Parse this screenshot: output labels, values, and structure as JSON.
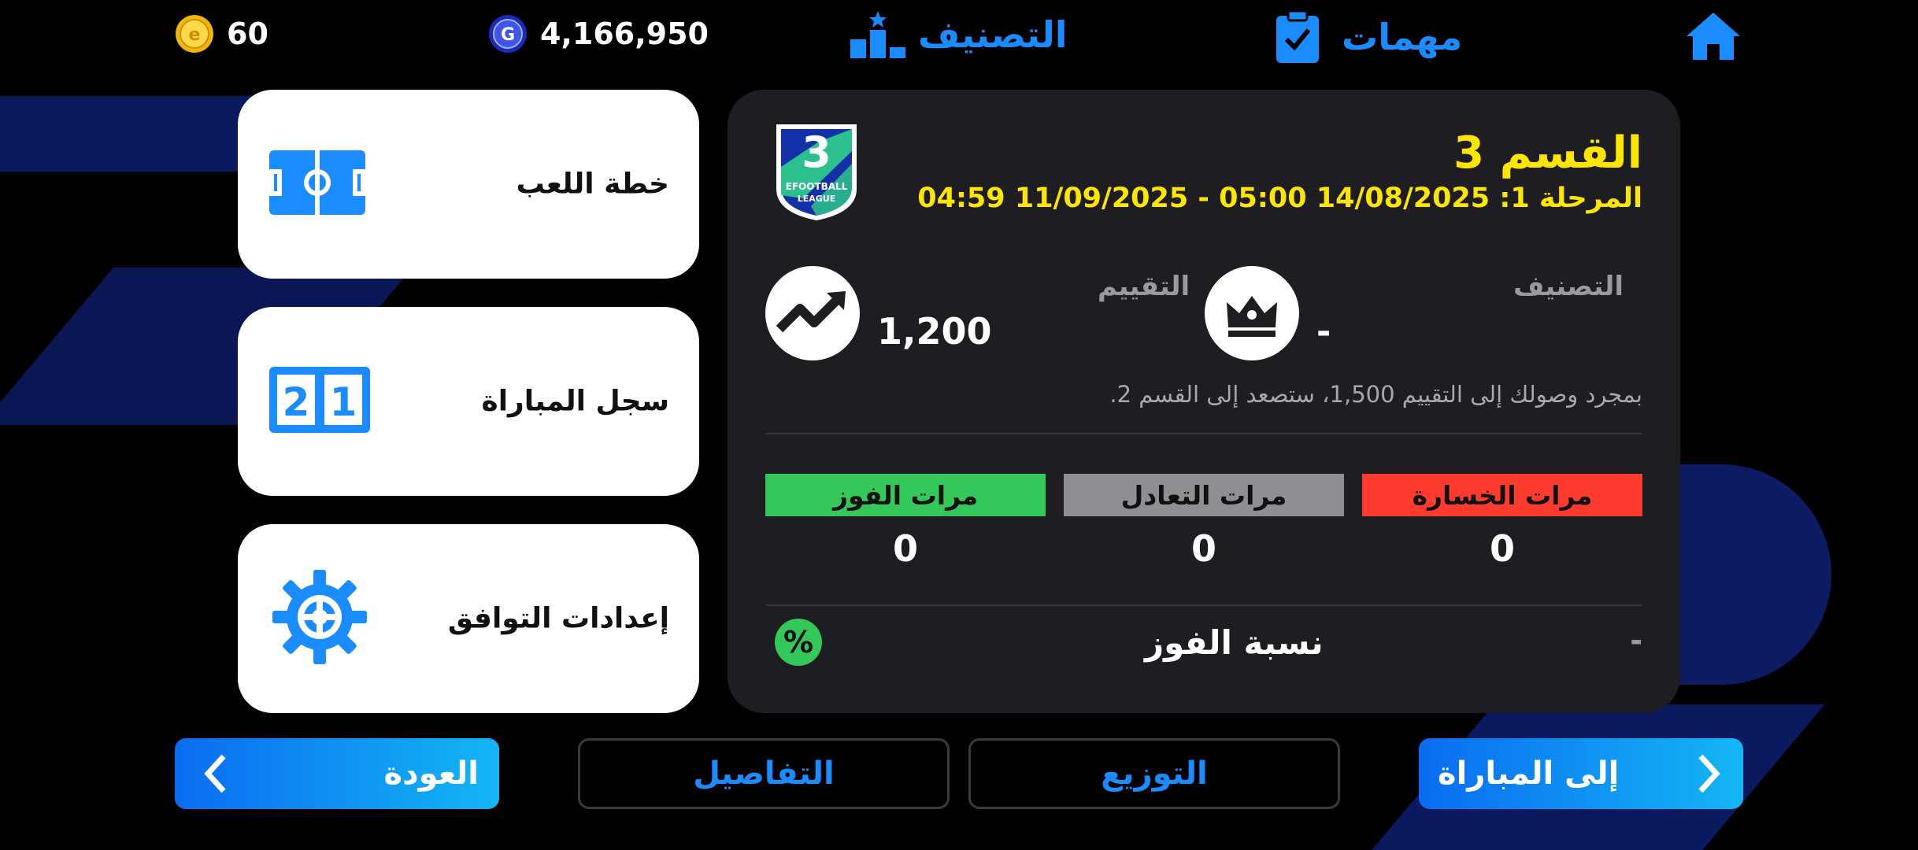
{
  "topbar": {
    "coins": "60",
    "gp": "4,166,950",
    "ranking_label": "التصنيف",
    "missions_label": "مهمات"
  },
  "cards": {
    "game_plan": "خطة اللعب",
    "match_record": "سجل المباراة",
    "compat_settings": "إعدادات التوافق"
  },
  "division": {
    "title": "القسم 3",
    "badge_number": "3",
    "badge_text_1": "EFOOTBALL",
    "badge_text_2": "LEAGUE",
    "phase": "المرحلة 1: 14/08/2025 05:00 - 11/09/2025 04:59",
    "ranking_label": "التصنيف",
    "ranking_value": "-",
    "rating_label": "التقييم",
    "rating_value": "1,200",
    "promo_text": "بمجرد وصولك إلى التقييم 1,500، ستصعد إلى القسم 2."
  },
  "stats": {
    "losses_label": "مرات الخسارة",
    "draws_label": "مرات التعادل",
    "wins_label": "مرات الفوز",
    "losses": "0",
    "draws": "0",
    "wins": "0",
    "win_rate_label": "نسبة الفوز",
    "win_rate_value": "-",
    "percent_symbol": "%"
  },
  "buttons": {
    "back": "العودة",
    "details": "التفاصيل",
    "distribution": "التوزيع",
    "to_match": "إلى المباراة"
  },
  "colors": {
    "accent_blue": "#1a8cff",
    "division_yellow": "#ffe600",
    "loss_red": "#ff3b30",
    "draw_gray": "#8e8e93",
    "win_green": "#34c759"
  }
}
